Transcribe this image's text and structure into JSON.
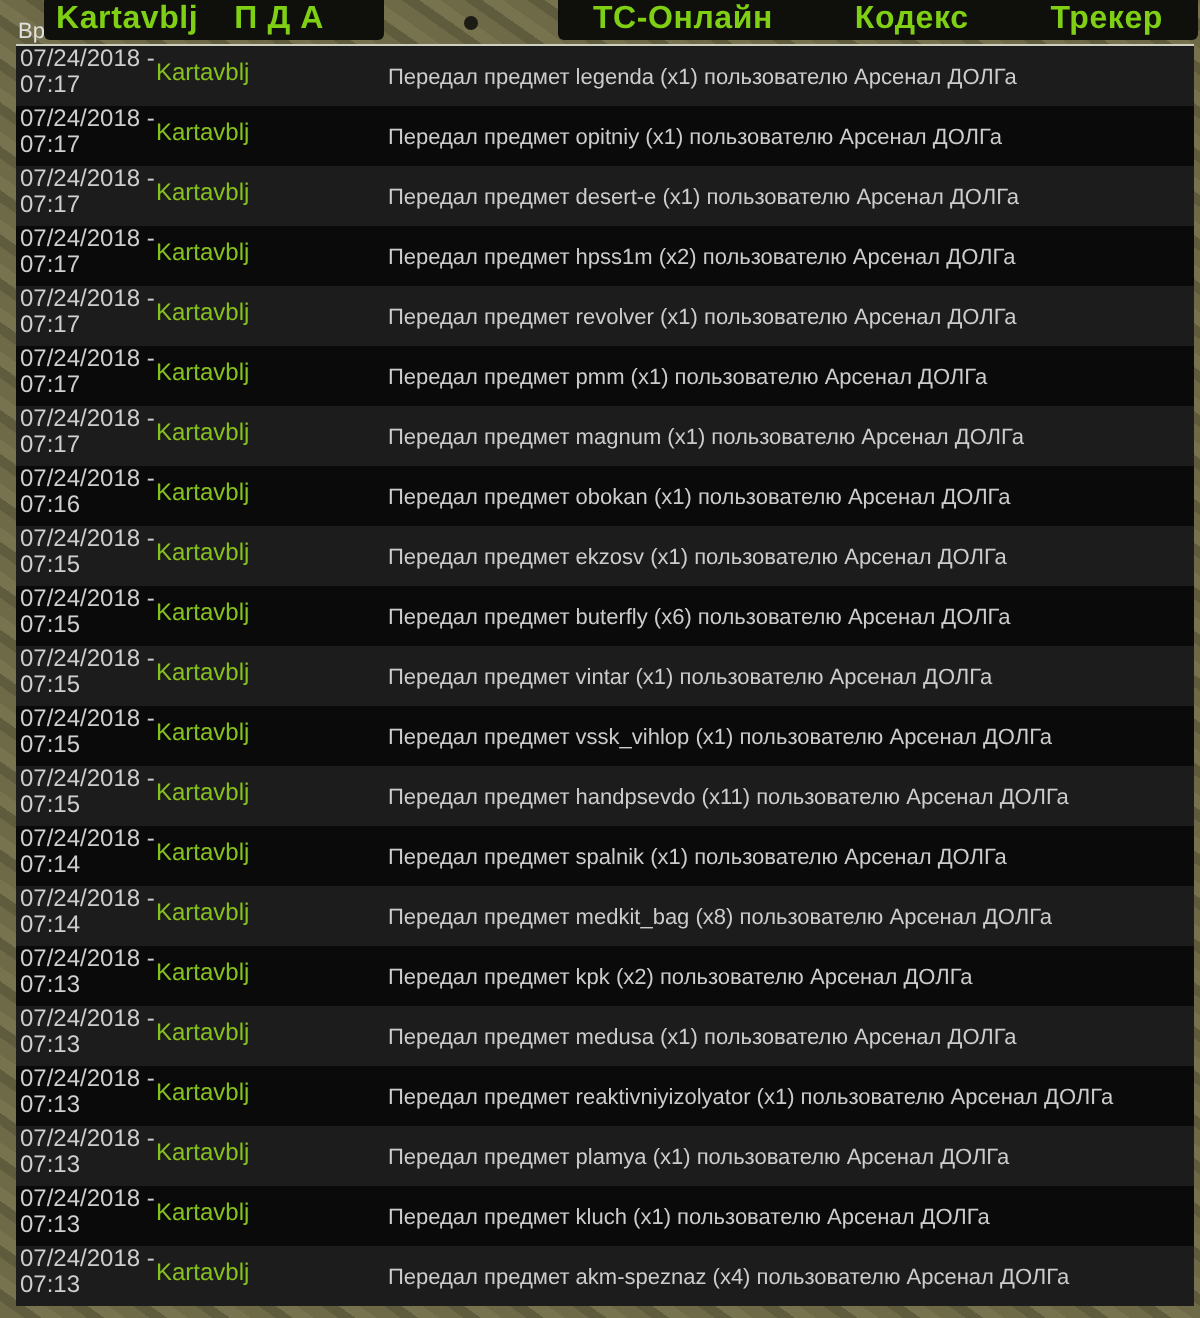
{
  "header": {
    "column_label": "Вр",
    "left_nav": [
      "Kartavblj",
      "П Д А"
    ],
    "right_nav": [
      "ТС-Онлайн",
      "Кодекс",
      "Трекер"
    ]
  },
  "rows": [
    {
      "time": "07/24/2018 - 07:17",
      "user": "Kartavblj",
      "message": "Передал предмет legenda (x1) пользователю Арсенал ДОЛГа"
    },
    {
      "time": "07/24/2018 - 07:17",
      "user": "Kartavblj",
      "message": "Передал предмет opitniy (x1) пользователю Арсенал ДОЛГа"
    },
    {
      "time": "07/24/2018 - 07:17",
      "user": "Kartavblj",
      "message": "Передал предмет desert-e (x1) пользователю Арсенал ДОЛГа"
    },
    {
      "time": "07/24/2018 - 07:17",
      "user": "Kartavblj",
      "message": "Передал предмет hpss1m (x2) пользователю Арсенал ДОЛГа"
    },
    {
      "time": "07/24/2018 - 07:17",
      "user": "Kartavblj",
      "message": "Передал предмет revolver (x1) пользователю Арсенал ДОЛГа"
    },
    {
      "time": "07/24/2018 - 07:17",
      "user": "Kartavblj",
      "message": "Передал предмет pmm (x1) пользователю Арсенал ДОЛГа"
    },
    {
      "time": "07/24/2018 - 07:17",
      "user": "Kartavblj",
      "message": "Передал предмет magnum (x1) пользователю Арсенал ДОЛГа"
    },
    {
      "time": "07/24/2018 - 07:16",
      "user": "Kartavblj",
      "message": "Передал предмет obokan (x1) пользователю Арсенал ДОЛГа"
    },
    {
      "time": "07/24/2018 - 07:15",
      "user": "Kartavblj",
      "message": "Передал предмет ekzosv (x1) пользователю Арсенал ДОЛГа"
    },
    {
      "time": "07/24/2018 - 07:15",
      "user": "Kartavblj",
      "message": "Передал предмет buterfly (x6) пользователю Арсенал ДОЛГа"
    },
    {
      "time": "07/24/2018 - 07:15",
      "user": "Kartavblj",
      "message": "Передал предмет vintar (x1) пользователю Арсенал ДОЛГа"
    },
    {
      "time": "07/24/2018 - 07:15",
      "user": "Kartavblj",
      "message": "Передал предмет vssk_vihlop (x1) пользователю Арсенал ДОЛГа"
    },
    {
      "time": "07/24/2018 - 07:15",
      "user": "Kartavblj",
      "message": "Передал предмет handpsevdo (x11) пользователю Арсенал ДОЛГа"
    },
    {
      "time": "07/24/2018 - 07:14",
      "user": "Kartavblj",
      "message": "Передал предмет spalnik (x1) пользователю Арсенал ДОЛГа"
    },
    {
      "time": "07/24/2018 - 07:14",
      "user": "Kartavblj",
      "message": "Передал предмет medkit_bag (x8) пользователю Арсенал ДОЛГа"
    },
    {
      "time": "07/24/2018 - 07:13",
      "user": "Kartavblj",
      "message": "Передал предмет kpk (x2) пользователю Арсенал ДОЛГа"
    },
    {
      "time": "07/24/2018 - 07:13",
      "user": "Kartavblj",
      "message": "Передал предмет medusa (x1) пользователю Арсенал ДОЛГа"
    },
    {
      "time": "07/24/2018 - 07:13",
      "user": "Kartavblj",
      "message": "Передал предмет reaktivniyizolyator (x1) пользователю Арсенал ДОЛГа"
    },
    {
      "time": "07/24/2018 - 07:13",
      "user": "Kartavblj",
      "message": "Передал предмет plamya (x1) пользователю Арсенал ДОЛГа"
    },
    {
      "time": "07/24/2018 - 07:13",
      "user": "Kartavblj",
      "message": "Передал предмет kluch (x1) пользователю Арсенал ДОЛГа"
    },
    {
      "time": "07/24/2018 - 07:13",
      "user": "Kartavblj",
      "message": "Передал предмет akm-speznaz (x4) пользователю Арсенал ДОЛГа"
    }
  ]
}
